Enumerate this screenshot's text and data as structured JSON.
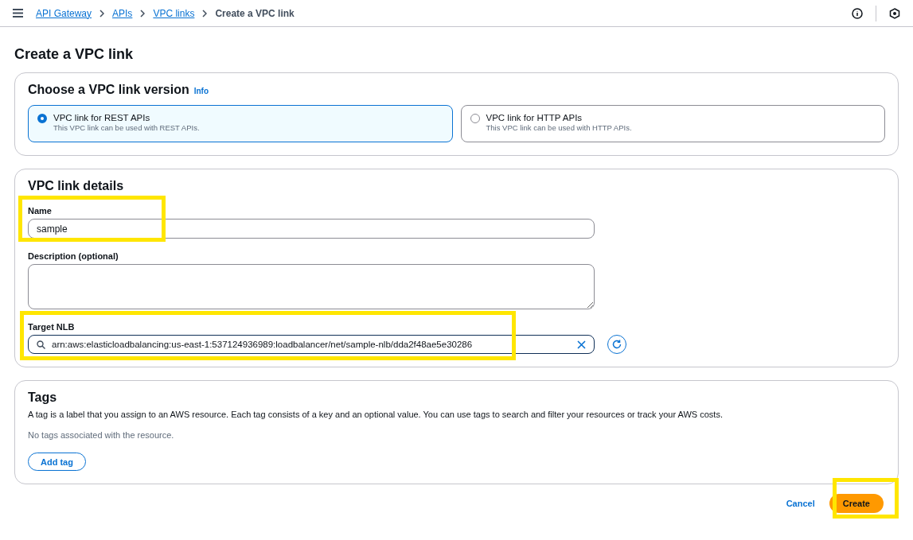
{
  "breadcrumbs": [
    {
      "label": "API Gateway",
      "link": true
    },
    {
      "label": "APIs",
      "link": true
    },
    {
      "label": "VPC links",
      "link": true
    },
    {
      "label": "Create a VPC link",
      "link": false
    }
  ],
  "page_title": "Create a VPC link",
  "version_card": {
    "title": "Choose a VPC link version",
    "info": "Info",
    "options": [
      {
        "label": "VPC link for REST APIs",
        "description": "This VPC link can be used with REST APIs.",
        "selected": true
      },
      {
        "label": "VPC link for HTTP APIs",
        "description": "This VPC link can be used with HTTP APIs.",
        "selected": false
      }
    ]
  },
  "details_card": {
    "title": "VPC link details",
    "name": {
      "label": "Name",
      "value": "sample"
    },
    "description": {
      "label": "Description (optional)"
    },
    "target_nlb": {
      "label": "Target NLB",
      "value": "arn:aws:elasticloadbalancing:us-east-1:537124936989:loadbalancer/net/sample-nlb/dda2f48ae5e30286"
    }
  },
  "tags_card": {
    "title": "Tags",
    "description": "A tag is a label that you assign to an AWS resource. Each tag consists of a key and an optional value. You can use tags to search and filter your resources or track your AWS costs.",
    "empty_text": "No tags associated with the resource.",
    "add_button": "Add tag"
  },
  "footer": {
    "cancel": "Cancel",
    "create": "Create"
  }
}
